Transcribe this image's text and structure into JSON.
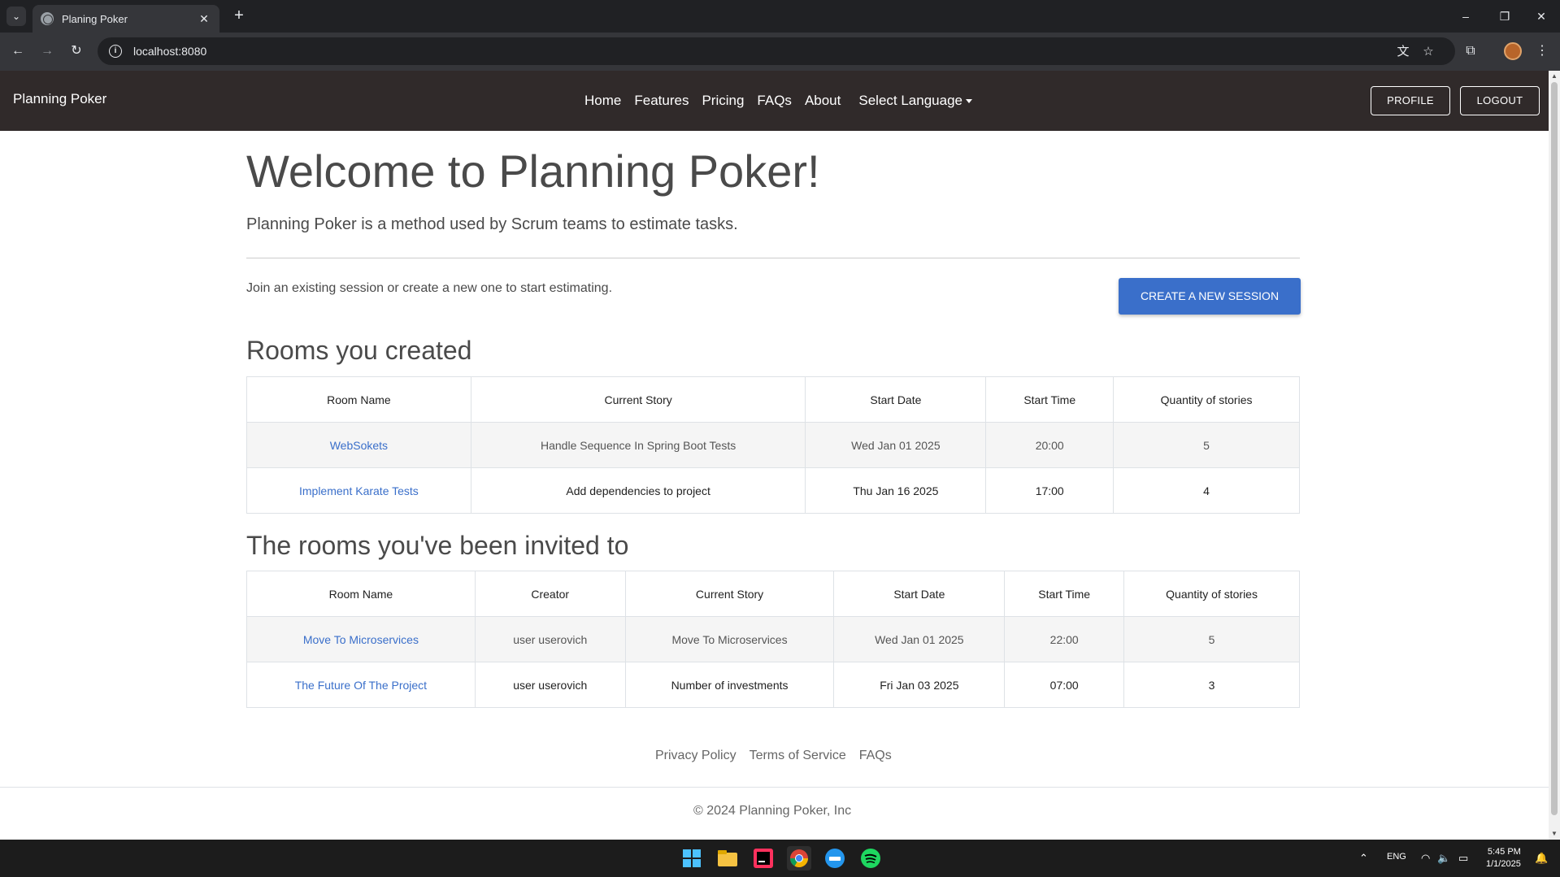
{
  "browser": {
    "tab_title": "Planing Poker",
    "url": "localhost:8080"
  },
  "navbar": {
    "brand": "Planning Poker",
    "links": [
      "Home",
      "Features",
      "Pricing",
      "FAQs",
      "About"
    ],
    "language": "Select Language",
    "profile": "PROFILE",
    "logout": "LOGOUT"
  },
  "hero": {
    "title": "Welcome to Planning Poker!",
    "lead": "Planning Poker is a method used by Scrum teams to estimate tasks.",
    "join_text": "Join an existing session or create a new one to start estimating.",
    "create_button": "CREATE A NEW SESSION"
  },
  "created_rooms": {
    "heading": "Rooms you created",
    "columns": [
      "Room Name",
      "Current Story",
      "Start Date",
      "Start Time",
      "Quantity of stories"
    ],
    "rows": [
      [
        "WebSokets",
        "Handle Sequence In Spring Boot Tests",
        "Wed Jan 01 2025",
        "20:00",
        "5"
      ],
      [
        "Implement Karate Tests",
        "Add dependencies to project",
        "Thu Jan 16 2025",
        "17:00",
        "4"
      ]
    ]
  },
  "invited_rooms": {
    "heading": "The rooms you've been invited to",
    "columns": [
      "Room Name",
      "Creator",
      "Current Story",
      "Start Date",
      "Start Time",
      "Quantity of stories"
    ],
    "rows": [
      [
        "Move To Microservices",
        "user userovich",
        "Move To Microservices",
        "Wed Jan 01 2025",
        "22:00",
        "5"
      ],
      [
        "The Future Of The Project",
        "user userovich",
        "Number of investments",
        "Fri Jan 03 2025",
        "07:00",
        "3"
      ]
    ]
  },
  "footer": {
    "links": [
      "Privacy Policy",
      "Terms of Service",
      "FAQs"
    ],
    "copyright": "© 2024 Planning Poker, Inc"
  },
  "taskbar": {
    "language": "ENG",
    "time": "5:45 PM",
    "date": "1/1/2025"
  },
  "colors": {
    "navbar_bg": "#302a2a",
    "accent": "#3a6fca"
  }
}
